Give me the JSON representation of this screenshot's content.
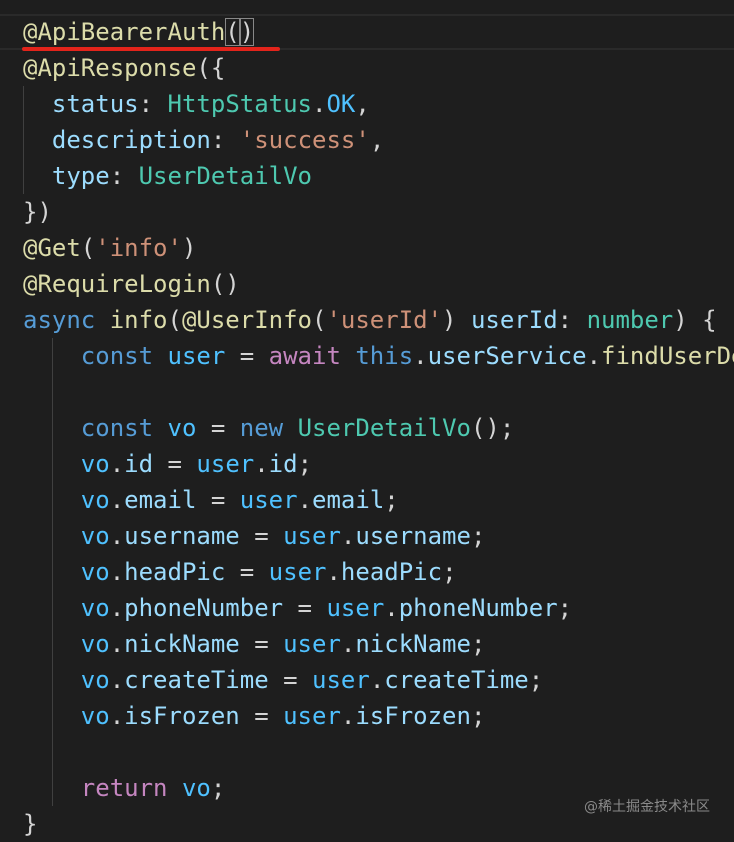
{
  "lines": [
    {
      "t": [
        [
          "dec",
          "@ApiBearerAuth"
        ],
        [
          "pun",
          "("
        ],
        [
          "pun",
          ")"
        ]
      ]
    },
    {
      "t": [
        [
          "dec",
          "@ApiResponse"
        ],
        [
          "pun",
          "({"
        ]
      ]
    },
    {
      "t": [
        [
          "pun",
          "  "
        ],
        [
          "prop",
          "status"
        ],
        [
          "pun",
          ": "
        ],
        [
          "typ",
          "HttpStatus"
        ],
        [
          "pun",
          "."
        ],
        [
          "vari",
          "OK"
        ],
        [
          "pun",
          ","
        ]
      ]
    },
    {
      "t": [
        [
          "pun",
          "  "
        ],
        [
          "prop",
          "description"
        ],
        [
          "pun",
          ": "
        ],
        [
          "str",
          "'success'"
        ],
        [
          "pun",
          ","
        ]
      ]
    },
    {
      "t": [
        [
          "pun",
          "  "
        ],
        [
          "prop",
          "type"
        ],
        [
          "pun",
          ": "
        ],
        [
          "typ",
          "UserDetailVo"
        ]
      ]
    },
    {
      "t": [
        [
          "pun",
          "})"
        ]
      ]
    },
    {
      "t": [
        [
          "dec",
          "@Get"
        ],
        [
          "pun",
          "("
        ],
        [
          "str",
          "'info'"
        ],
        [
          "pun",
          ")"
        ]
      ]
    },
    {
      "t": [
        [
          "dec",
          "@RequireLogin"
        ],
        [
          "pun",
          "()"
        ]
      ]
    },
    {
      "t": [
        [
          "kw",
          "async"
        ],
        [
          "pun",
          " "
        ],
        [
          "fn",
          "info"
        ],
        [
          "pun",
          "("
        ],
        [
          "dec",
          "@UserInfo"
        ],
        [
          "pun",
          "("
        ],
        [
          "str",
          "'userId'"
        ],
        [
          "pun",
          ") "
        ],
        [
          "prop",
          "userId"
        ],
        [
          "pun",
          ": "
        ],
        [
          "typ",
          "number"
        ],
        [
          "pun",
          ") {"
        ]
      ]
    },
    {
      "t": [
        [
          "pun",
          "    "
        ],
        [
          "kw",
          "const"
        ],
        [
          "pun",
          " "
        ],
        [
          "vari",
          "user"
        ],
        [
          "pun",
          " = "
        ],
        [
          "ctl",
          "await"
        ],
        [
          "pun",
          " "
        ],
        [
          "kw",
          "this"
        ],
        [
          "pun",
          "."
        ],
        [
          "prop",
          "userService"
        ],
        [
          "pun",
          "."
        ],
        [
          "fn",
          "findUserDe"
        ]
      ]
    },
    {
      "t": []
    },
    {
      "t": [
        [
          "pun",
          "    "
        ],
        [
          "kw",
          "const"
        ],
        [
          "pun",
          " "
        ],
        [
          "vari",
          "vo"
        ],
        [
          "pun",
          " = "
        ],
        [
          "kw",
          "new"
        ],
        [
          "pun",
          " "
        ],
        [
          "typ",
          "UserDetailVo"
        ],
        [
          "pun",
          "();"
        ]
      ]
    },
    {
      "t": [
        [
          "pun",
          "    "
        ],
        [
          "vari",
          "vo"
        ],
        [
          "pun",
          "."
        ],
        [
          "prop",
          "id"
        ],
        [
          "pun",
          " = "
        ],
        [
          "vari",
          "user"
        ],
        [
          "pun",
          "."
        ],
        [
          "prop",
          "id"
        ],
        [
          "pun",
          ";"
        ]
      ]
    },
    {
      "t": [
        [
          "pun",
          "    "
        ],
        [
          "vari",
          "vo"
        ],
        [
          "pun",
          "."
        ],
        [
          "prop",
          "email"
        ],
        [
          "pun",
          " = "
        ],
        [
          "vari",
          "user"
        ],
        [
          "pun",
          "."
        ],
        [
          "prop",
          "email"
        ],
        [
          "pun",
          ";"
        ]
      ]
    },
    {
      "t": [
        [
          "pun",
          "    "
        ],
        [
          "vari",
          "vo"
        ],
        [
          "pun",
          "."
        ],
        [
          "prop",
          "username"
        ],
        [
          "pun",
          " = "
        ],
        [
          "vari",
          "user"
        ],
        [
          "pun",
          "."
        ],
        [
          "prop",
          "username"
        ],
        [
          "pun",
          ";"
        ]
      ]
    },
    {
      "t": [
        [
          "pun",
          "    "
        ],
        [
          "vari",
          "vo"
        ],
        [
          "pun",
          "."
        ],
        [
          "prop",
          "headPic"
        ],
        [
          "pun",
          " = "
        ],
        [
          "vari",
          "user"
        ],
        [
          "pun",
          "."
        ],
        [
          "prop",
          "headPic"
        ],
        [
          "pun",
          ";"
        ]
      ]
    },
    {
      "t": [
        [
          "pun",
          "    "
        ],
        [
          "vari",
          "vo"
        ],
        [
          "pun",
          "."
        ],
        [
          "prop",
          "phoneNumber"
        ],
        [
          "pun",
          " = "
        ],
        [
          "vari",
          "user"
        ],
        [
          "pun",
          "."
        ],
        [
          "prop",
          "phoneNumber"
        ],
        [
          "pun",
          ";"
        ]
      ]
    },
    {
      "t": [
        [
          "pun",
          "    "
        ],
        [
          "vari",
          "vo"
        ],
        [
          "pun",
          "."
        ],
        [
          "prop",
          "nickName"
        ],
        [
          "pun",
          " = "
        ],
        [
          "vari",
          "user"
        ],
        [
          "pun",
          "."
        ],
        [
          "prop",
          "nickName"
        ],
        [
          "pun",
          ";"
        ]
      ]
    },
    {
      "t": [
        [
          "pun",
          "    "
        ],
        [
          "vari",
          "vo"
        ],
        [
          "pun",
          "."
        ],
        [
          "prop",
          "createTime"
        ],
        [
          "pun",
          " = "
        ],
        [
          "vari",
          "user"
        ],
        [
          "pun",
          "."
        ],
        [
          "prop",
          "createTime"
        ],
        [
          "pun",
          ";"
        ]
      ]
    },
    {
      "t": [
        [
          "pun",
          "    "
        ],
        [
          "vari",
          "vo"
        ],
        [
          "pun",
          "."
        ],
        [
          "prop",
          "isFrozen"
        ],
        [
          "pun",
          " = "
        ],
        [
          "vari",
          "user"
        ],
        [
          "pun",
          "."
        ],
        [
          "prop",
          "isFrozen"
        ],
        [
          "pun",
          ";"
        ]
      ]
    },
    {
      "t": []
    },
    {
      "t": [
        [
          "pun",
          "    "
        ],
        [
          "ctl",
          "return"
        ],
        [
          "pun",
          " "
        ],
        [
          "vari",
          "vo"
        ],
        [
          "pun",
          ";"
        ]
      ]
    },
    {
      "t": [
        [
          "pun",
          "}"
        ]
      ]
    }
  ],
  "watermark": "@稀土掘金技术社区",
  "colors": {
    "background": "#1e1e1e",
    "decorator": "#dcdcaa",
    "keyword": "#569cd6",
    "control": "#c586c0",
    "type": "#4ec9b0",
    "property": "#9cdcfe",
    "variable": "#4fc1ff",
    "string": "#ce9178",
    "annotation_underline": "#e3241b"
  }
}
